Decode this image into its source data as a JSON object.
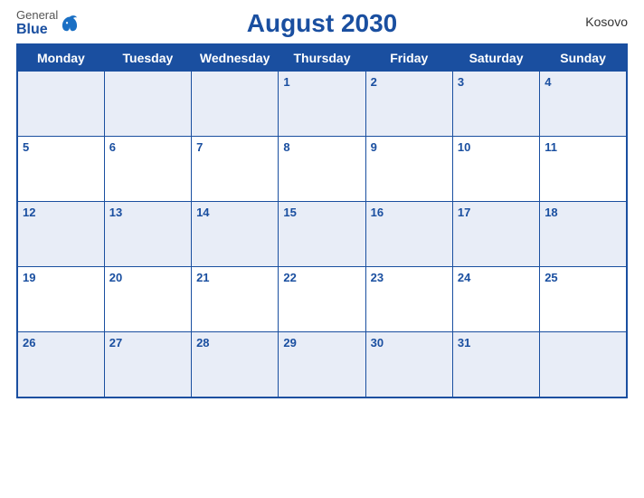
{
  "calendar": {
    "month_title": "August 2030",
    "country": "Kosovo",
    "logo": {
      "general": "General",
      "blue": "Blue"
    },
    "weekdays": [
      "Monday",
      "Tuesday",
      "Wednesday",
      "Thursday",
      "Friday",
      "Saturday",
      "Sunday"
    ],
    "weeks": [
      [
        null,
        null,
        null,
        1,
        2,
        3,
        4
      ],
      [
        5,
        6,
        7,
        8,
        9,
        10,
        11
      ],
      [
        12,
        13,
        14,
        15,
        16,
        17,
        18
      ],
      [
        19,
        20,
        21,
        22,
        23,
        24,
        25
      ],
      [
        26,
        27,
        28,
        29,
        30,
        31,
        null
      ]
    ]
  }
}
